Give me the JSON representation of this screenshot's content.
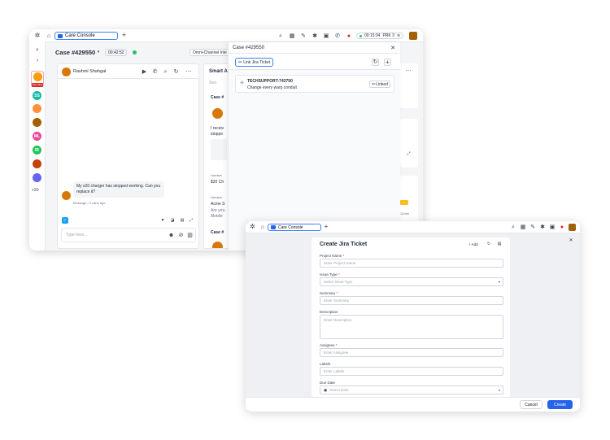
{
  "console": {
    "tab_label": "Care Console",
    "timer": "00:15:34",
    "prk_label": "PRK 3",
    "case_title": "Case #429550",
    "case_timer": "00:42:52",
    "channel_button": "Omni-Channel Inte",
    "sidebar_more": "+20",
    "sidebar_badge": "New Msg",
    "contacts": [
      {
        "initials": "SS",
        "color": "#14b8a6"
      },
      {
        "initials": "ML",
        "color": "#ec4899"
      },
      {
        "initials": "IR",
        "color": "#22c55e"
      }
    ],
    "chat": {
      "customer_name": "Rashmi Shahgal",
      "message": "My s20 charger has stopped working. Can you replace it?",
      "meta": "Message • 2 mins ago",
      "reply_placeholder": "Type here..."
    },
    "smart_panel": {
      "title": "Smart A",
      "search_fragment": "Sea",
      "case_label_1": "Case #",
      "snippet_1": "I receiv",
      "snippet_2": "stoppe",
      "hardware_label": "Hardwa",
      "item_1": "$20 Ch",
      "hardware_label_2": "Hardwa",
      "item_2": "Acme S",
      "item_2_sub": "Are you",
      "item_2_sub2": "Mobile",
      "case_label_2": "Case #",
      "time_fragment": "12min"
    },
    "jira_popup": {
      "title": "Case #429550",
      "link_button": "Link Jira Ticket",
      "ticket_id": "TECHSUPPORT-743790",
      "ticket_desc": "Change every warp conduit",
      "linked_label": "Linked"
    }
  },
  "create_form": {
    "tab_label": "Care Console",
    "title": "Create Jira Ticket",
    "add_label": "+ Add",
    "fields": [
      {
        "label": "Project Name",
        "required": true,
        "placeholder": "Enter Project Name"
      },
      {
        "label": "Issue Type",
        "required": true,
        "placeholder": "Select Issue Type"
      },
      {
        "label": "Summary",
        "required": true,
        "placeholder": "Enter Summary"
      },
      {
        "label": "Description",
        "required": false,
        "placeholder": "Enter Description"
      },
      {
        "label": "Assignee",
        "required": true,
        "placeholder": "Enter Assignee"
      },
      {
        "label": "Labels",
        "required": false,
        "placeholder": "Enter Labels"
      },
      {
        "label": "Due Date",
        "required": false,
        "placeholder": "Select Date"
      }
    ],
    "cancel_label": "Cancel",
    "create_label": "Create"
  },
  "colors": {
    "accent": "#2563eb",
    "danger": "#dc2626",
    "success": "#22c55e",
    "twitter": "#1da1f2"
  }
}
